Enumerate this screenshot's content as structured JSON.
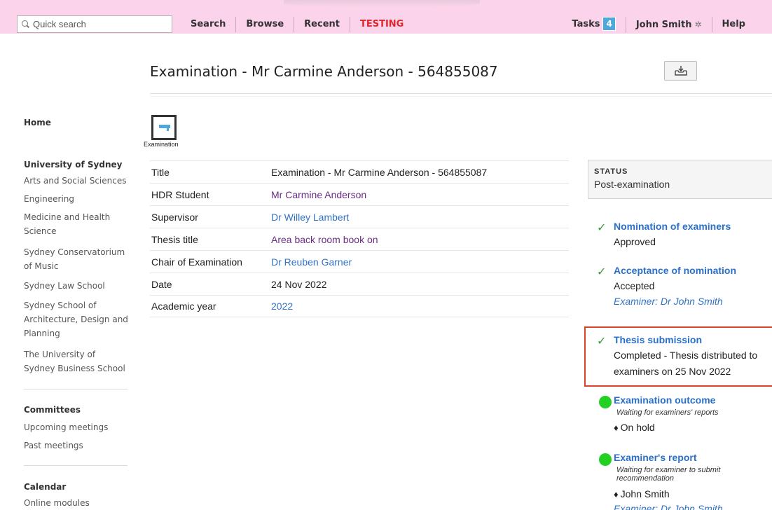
{
  "topbar": {
    "search_placeholder": "Quick search",
    "nav_left": [
      "Search",
      "Browse",
      "Recent",
      "TESTING"
    ],
    "tasks_label": "Tasks",
    "tasks_count": "4",
    "user_name": "John Smith",
    "help_label": "Help"
  },
  "page": {
    "title": "Examination - Mr Carmine Anderson - 564855087",
    "record_type": "Examination"
  },
  "sidebar": {
    "home": "Home",
    "university_heading": "University of Sydney",
    "faculties": [
      "Arts and Social Sciences",
      "Engineering",
      "Medicine and Health Science",
      "Sydney Conservatorium of Music",
      "Sydney Law School",
      "Sydney School of Architecture, Design and Planning",
      "The University of Sydney Business School"
    ],
    "committees_heading": "Committees",
    "committee_links": [
      "Upcoming meetings",
      "Past meetings"
    ],
    "calendar_heading": "Calendar",
    "calendar_links": [
      "Online modules"
    ]
  },
  "details": [
    {
      "label": "Title",
      "value": "Examination - Mr Carmine Anderson - 564855087",
      "style": "plain"
    },
    {
      "label": "HDR Student",
      "value": "Mr Carmine Anderson",
      "style": "visited"
    },
    {
      "label": "Supervisor",
      "value": "Dr Willey Lambert",
      "style": "link"
    },
    {
      "label": "Thesis title",
      "value": "Area back room book on",
      "style": "visited"
    },
    {
      "label": "Chair of Examination",
      "value": "Dr Reuben Garner",
      "style": "link"
    },
    {
      "label": "Date",
      "value": "24 Nov 2022",
      "style": "plain"
    },
    {
      "label": "Academic year",
      "value": "2022",
      "style": "link"
    }
  ],
  "status": {
    "caption": "STATUS",
    "value": "Post-examination"
  },
  "workflow": [
    {
      "title": "Nomination of examiners",
      "state": "complete",
      "status": "Approved"
    },
    {
      "title": "Acceptance of nomination",
      "state": "complete",
      "status": "Accepted",
      "examiner": "Examiner: Dr John Smith"
    },
    {
      "title": "Thesis submission",
      "state": "complete",
      "status_line1": "Completed - Thesis distributed to",
      "status_line2": "examiners on 25 Nov 2022"
    },
    {
      "title": "Examination outcome",
      "state": "in-progress",
      "info": "Waiting for examiners' reports",
      "person": "On hold"
    },
    {
      "title": "Examiner's report",
      "state": "in-progress",
      "info": "Waiting for examiner to submit recommendation",
      "person": "John Smith",
      "examiner": "Examiner: Dr John Smith"
    }
  ],
  "colors": {
    "topbar_bg": "#fbd3ea",
    "testing": "#e0262c",
    "link": "#3273c7",
    "visited": "#6a2c86",
    "check": "#3b9a3b",
    "progress_dot": "#22d022",
    "highlight": "#d9452b"
  }
}
